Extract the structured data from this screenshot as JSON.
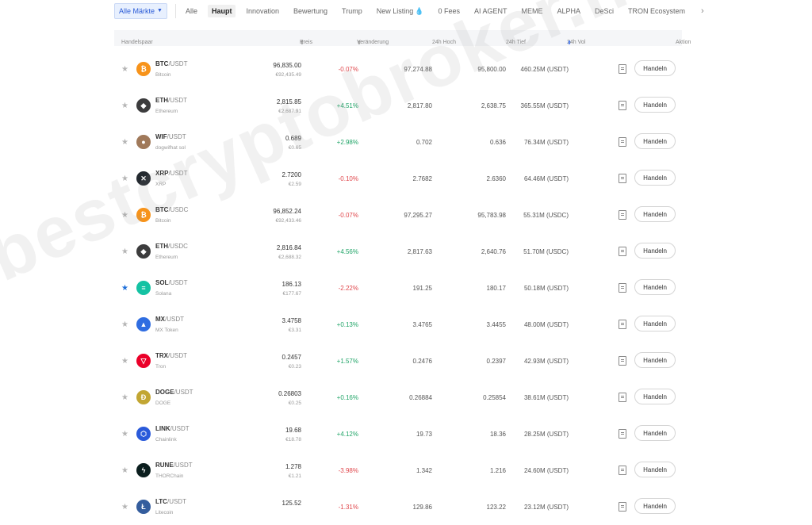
{
  "tabs": {
    "primary": "Alle Märkte",
    "items": [
      "Alle",
      "Haupt",
      "Innovation",
      "Bewertung",
      "Trump",
      "New Listing",
      "0 Fees",
      "AI AGENT",
      "MEME",
      "ALPHA",
      "DeSci",
      "TRON Ecosystem"
    ],
    "active": "Haupt"
  },
  "header": {
    "pair": "Handelspaar",
    "price": "Preis",
    "change": "Veränderung",
    "high": "24h Hoch",
    "low": "24h Tief",
    "vol": "24h Vol",
    "action": "Aktion"
  },
  "rows": [
    {
      "base": "BTC",
      "quote": "/USDT",
      "name": "Bitcoin",
      "price": "96,835.00",
      "eur": "€92,435.49",
      "change": "-0.07%",
      "high": "97,274.88",
      "low": "95,800.00",
      "vol": "460.25M (USDT)",
      "starred": false,
      "icon": "bitcoin-icon",
      "icon_glyph": "₿",
      "icon_color": "#f7931a"
    },
    {
      "base": "ETH",
      "quote": "/USDT",
      "name": "Ethereum",
      "price": "2,815.85",
      "eur": "€2,687.91",
      "change": "+4.51%",
      "high": "2,817.80",
      "low": "2,638.75",
      "vol": "365.55M (USDT)",
      "starred": false,
      "icon": "ethereum-icon",
      "icon_glyph": "◆",
      "icon_color": "#3c3c3d"
    },
    {
      "base": "WIF",
      "quote": "/USDT",
      "name": "dogwifhat sol",
      "price": "0.689",
      "eur": "€0.65",
      "change": "+2.98%",
      "high": "0.702",
      "low": "0.636",
      "vol": "76.34M (USDT)",
      "starred": false,
      "icon": "dogwifhat-icon",
      "icon_glyph": "●",
      "icon_color": "#a0795a"
    },
    {
      "base": "XRP",
      "quote": "/USDT",
      "name": "XRP",
      "price": "2.7200",
      "eur": "€2.59",
      "change": "-0.10%",
      "high": "2.7682",
      "low": "2.6360",
      "vol": "64.46M (USDT)",
      "starred": false,
      "icon": "xrp-icon",
      "icon_glyph": "✕",
      "icon_color": "#23292f"
    },
    {
      "base": "BTC",
      "quote": "/USDC",
      "name": "Bitcoin",
      "price": "96,852.24",
      "eur": "€92,433.46",
      "change": "-0.07%",
      "high": "97,295.27",
      "low": "95,783.98",
      "vol": "55.31M (USDC)",
      "starred": false,
      "icon": "bitcoin-icon",
      "icon_glyph": "₿",
      "icon_color": "#f7931a"
    },
    {
      "base": "ETH",
      "quote": "/USDC",
      "name": "Ethereum",
      "price": "2,816.84",
      "eur": "€2,688.32",
      "change": "+4.56%",
      "high": "2,817.63",
      "low": "2,640.76",
      "vol": "51.70M (USDC)",
      "starred": false,
      "icon": "ethereum-icon",
      "icon_glyph": "◆",
      "icon_color": "#3c3c3d"
    },
    {
      "base": "SOL",
      "quote": "/USDT",
      "name": "Solana",
      "price": "186.13",
      "eur": "€177.67",
      "change": "-2.22%",
      "high": "191.25",
      "low": "180.17",
      "vol": "50.18M (USDT)",
      "starred": true,
      "icon": "solana-icon",
      "icon_glyph": "≡",
      "icon_color": "#14c2a3"
    },
    {
      "base": "MX",
      "quote": "/USDT",
      "name": "MX Token",
      "price": "3.4758",
      "eur": "€3.31",
      "change": "+0.13%",
      "high": "3.4765",
      "low": "3.4455",
      "vol": "48.00M (USDT)",
      "starred": false,
      "icon": "mx-token-icon",
      "icon_glyph": "▲",
      "icon_color": "#2f6de1"
    },
    {
      "base": "TRX",
      "quote": "/USDT",
      "name": "Tron",
      "price": "0.2457",
      "eur": "€0.23",
      "change": "+1.57%",
      "high": "0.2476",
      "low": "0.2397",
      "vol": "42.93M (USDT)",
      "starred": false,
      "icon": "tron-icon",
      "icon_glyph": "▽",
      "icon_color": "#eb0029"
    },
    {
      "base": "DOGE",
      "quote": "/USDT",
      "name": "DOGE",
      "price": "0.26803",
      "eur": "€0.25",
      "change": "+0.16%",
      "high": "0.26884",
      "low": "0.25854",
      "vol": "38.61M (USDT)",
      "starred": false,
      "icon": "dogecoin-icon",
      "icon_glyph": "Ð",
      "icon_color": "#c2a633"
    },
    {
      "base": "LINK",
      "quote": "/USDT",
      "name": "Chainlink",
      "price": "19.68",
      "eur": "€18.78",
      "change": "+4.12%",
      "high": "19.73",
      "low": "18.36",
      "vol": "28.25M (USDT)",
      "starred": false,
      "icon": "chainlink-icon",
      "icon_glyph": "⬡",
      "icon_color": "#2a5ada"
    },
    {
      "base": "RUNE",
      "quote": "/USDT",
      "name": "THORChain",
      "price": "1.278",
      "eur": "€1.21",
      "change": "-3.98%",
      "high": "1.342",
      "low": "1.216",
      "vol": "24.60M (USDT)",
      "starred": false,
      "icon": "thorchain-icon",
      "icon_glyph": "ϟ",
      "icon_color": "#0b1e1e"
    },
    {
      "base": "LTC",
      "quote": "/USDT",
      "name": "Litecoin",
      "price": "125.52",
      "eur": "",
      "change": "-1.31%",
      "high": "129.86",
      "low": "123.22",
      "vol": "23.12M (USDT)",
      "starred": false,
      "icon": "litecoin-icon",
      "icon_glyph": "Ł",
      "icon_color": "#345d9d"
    }
  ],
  "trade_label": "Handeln",
  "watermark": "bestcryptobroker.nl/de"
}
